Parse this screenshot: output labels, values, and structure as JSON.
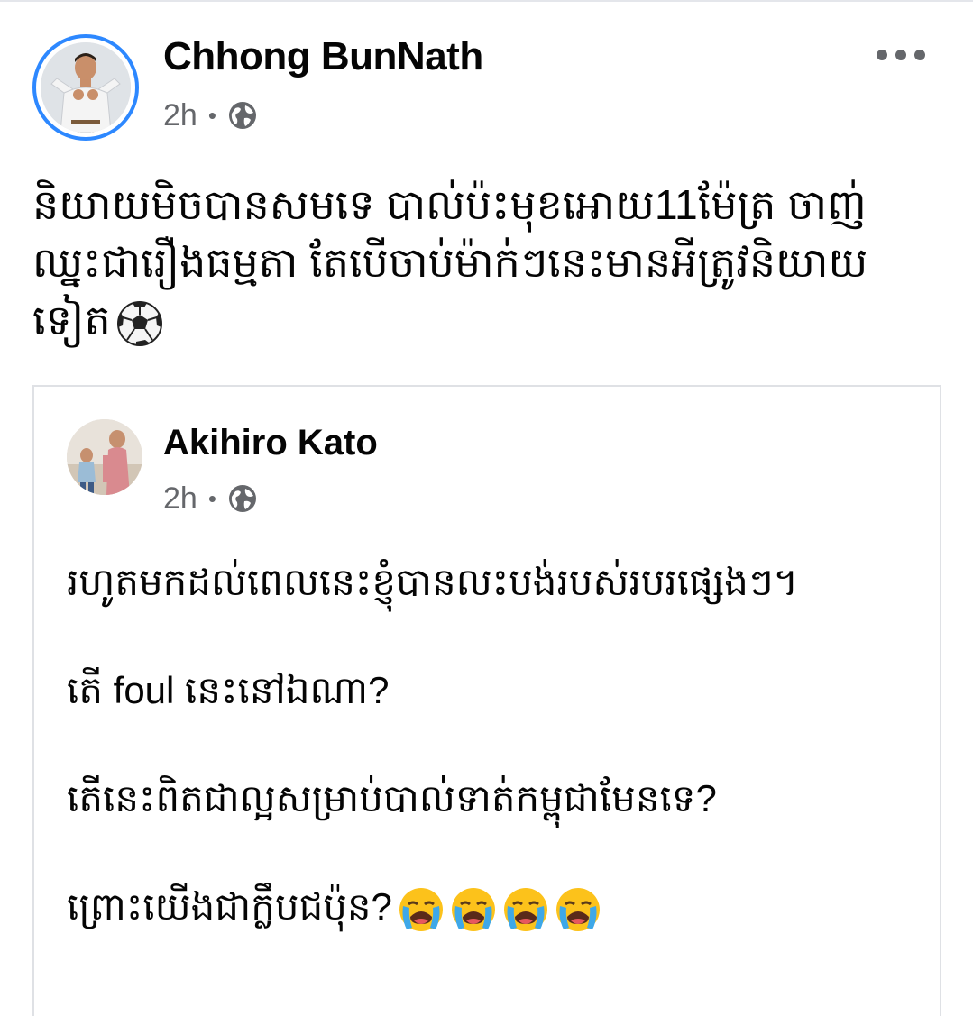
{
  "post": {
    "author": "Chhong BunNath",
    "time": "2h",
    "separator": "•",
    "audience_icon": "globe-icon",
    "text_lines": [
      "និយាយមិចបានសមទេ បាល់ប៉ះមុខអោយ11ម៉ែត្រ ចាញ់",
      "ឈ្នះជារឿងធម្មតា តែបើចាប់ម៉ាក់ៗនេះមានអីត្រូវនិយាយ",
      "ទៀត"
    ],
    "emoji": "soccer-ball-icon"
  },
  "shared_post": {
    "author": "Akihiro Kato",
    "time": "2h",
    "separator": "•",
    "audience_icon": "globe-icon",
    "paragraphs": [
      "រហូតមកដល់ពេលនេះខ្ញុំបានលះបង់របស់របរផ្សេងៗ។",
      "តើ foul នេះនៅឯណា?",
      "តើនេះពិតជាល្អសម្រាប់បាល់ទាត់កម្ពុជាមែនទេ?",
      "ព្រោះយើងជាក្លឹបជប៉ុន?"
    ],
    "emoji": "loudly-crying-face-icon",
    "emoji_count": 4
  },
  "colors": {
    "story_ring": "#2d88ff",
    "secondary_text": "#65676b",
    "border": "#dfe1e5"
  }
}
